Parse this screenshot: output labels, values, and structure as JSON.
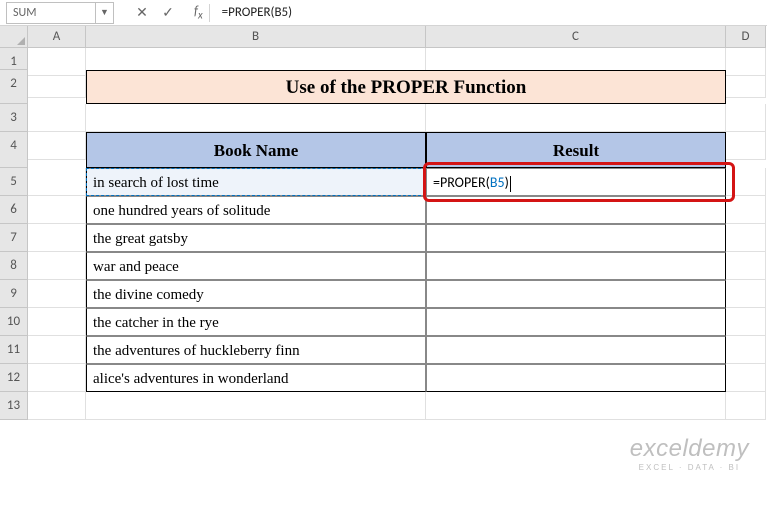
{
  "name_box": "SUM",
  "formula_bar": "=PROPER(B5)",
  "title": "Use of the PROPER Function",
  "headers": {
    "book": "Book Name",
    "result": "Result"
  },
  "books": [
    "in search of lost time",
    "one hundred years of solitude",
    "the great gatsby",
    "war and peace",
    "the divine comedy",
    "the catcher in the rye",
    "the adventures of huckleberry finn",
    "alice's adventures in wonderland"
  ],
  "editing_formula": {
    "prefix": "=PROPER(",
    "ref": "B5",
    "suffix": ")"
  },
  "columns": [
    "A",
    "B",
    "C",
    "D"
  ],
  "rows": [
    "1",
    "2",
    "3",
    "4",
    "5",
    "6",
    "7",
    "8",
    "9",
    "10",
    "11",
    "12",
    "13"
  ],
  "watermark": {
    "main": "exceldemy",
    "sub": "EXCEL · DATA · BI"
  }
}
